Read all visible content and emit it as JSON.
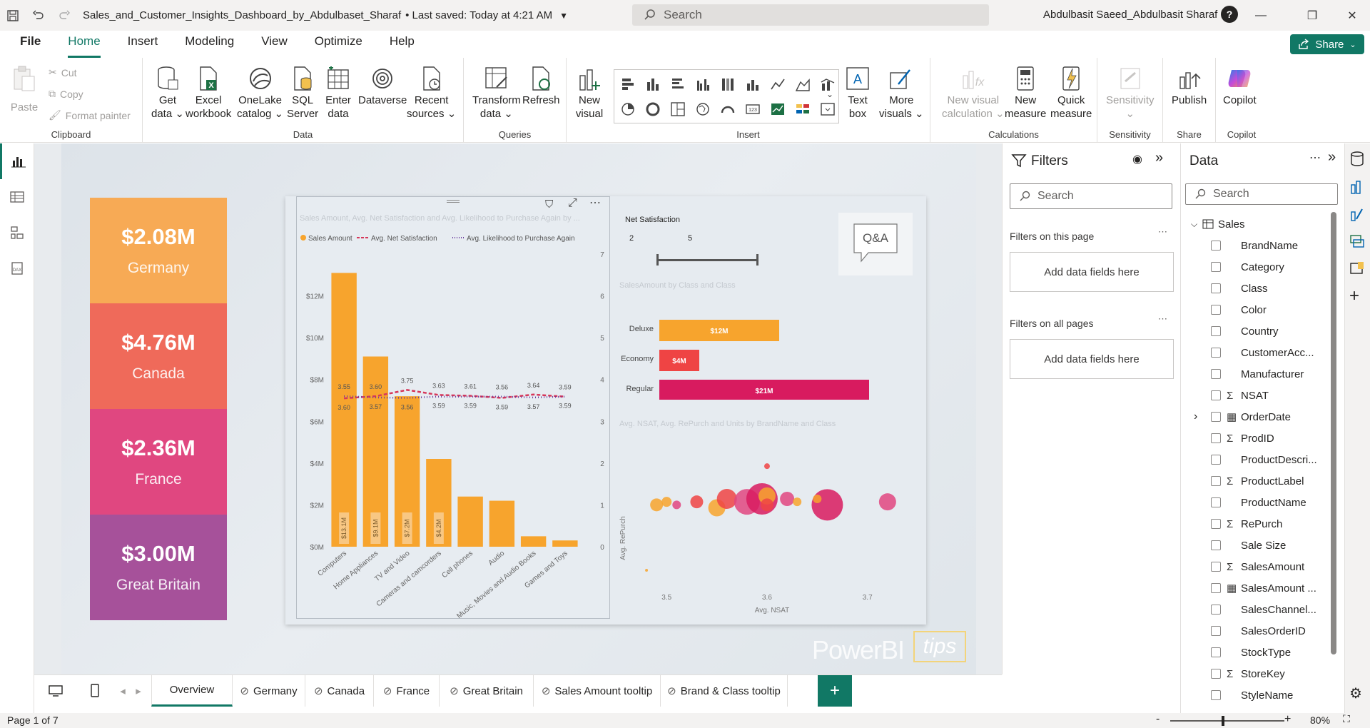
{
  "titlebar": {
    "doc_title": "Sales_and_Customer_Insights_Dashboard_by_Abdulbaset_Sharaf",
    "saved": "• Last saved: Today at 4:21 AM",
    "search_placeholder": "Search",
    "user": "Abdulbasit Saeed_Abdulbasit Sharaf"
  },
  "menu": {
    "items": [
      "File",
      "Home",
      "Insert",
      "Modeling",
      "View",
      "Optimize",
      "Help"
    ],
    "active": "Home",
    "share": "Share"
  },
  "ribbon": {
    "clipboard": {
      "paste": "Paste",
      "cut": "Cut",
      "copy": "Copy",
      "format_painter": "Format painter",
      "label": "Clipboard"
    },
    "data": {
      "buttons": [
        {
          "l1": "Get",
          "l2": "data ⌄"
        },
        {
          "l1": "Excel",
          "l2": "workbook"
        },
        {
          "l1": "OneLake",
          "l2": "catalog ⌄"
        },
        {
          "l1": "SQL",
          "l2": "Server"
        },
        {
          "l1": "Enter",
          "l2": "data"
        },
        {
          "l1": "Dataverse",
          "l2": ""
        },
        {
          "l1": "Recent",
          "l2": "sources ⌄"
        }
      ],
      "label": "Data"
    },
    "queries": {
      "transform_l1": "Transform",
      "transform_l2": "data ⌄",
      "refresh": "Refresh",
      "label": "Queries"
    },
    "insert": {
      "new_visual_l1": "New",
      "new_visual_l2": "visual",
      "text_box_l1": "Text",
      "text_box_l2": "box",
      "more_visuals_l1": "More",
      "more_visuals_l2": "visuals ⌄",
      "label": "Insert"
    },
    "calculations": {
      "nvc_l1": "New visual",
      "nvc_l2": "calculation ⌄",
      "nm_l1": "New",
      "nm_l2": "measure",
      "qm_l1": "Quick",
      "qm_l2": "measure",
      "label": "Calculations"
    },
    "sensitivity": {
      "btn": "Sensitivity",
      "label": "Sensitivity"
    },
    "share": {
      "publish": "Publish",
      "label": "Share"
    },
    "copilot": {
      "btn": "Copilot",
      "label": "Copilot"
    }
  },
  "cards": [
    {
      "value": "$2.08M",
      "label": "Germany",
      "color": "#f7aa55"
    },
    {
      "value": "$4.76M",
      "label": "Canada",
      "color": "#ef6a5a"
    },
    {
      "value": "$2.36M",
      "label": "France",
      "color": "#e04780"
    },
    {
      "value": "$3.00M",
      "label": "Great Britain",
      "color": "#a6519a"
    }
  ],
  "chart_data": [
    {
      "type": "bar",
      "title": "Sales Amount, Avg. Net Satisfaction and Avg. Likelihood to Purchase Again by ...",
      "legend": [
        "Sales Amount",
        "Avg. Net Satisfaction",
        "Avg. Likelihood to Purchase Again"
      ],
      "categories": [
        "Computers",
        "Home Appliances",
        "TV and Video",
        "Cameras and camcorders",
        "Cell phones",
        "Audio",
        "Music, Movies and Audio Books",
        "Games and Toys"
      ],
      "series": [
        {
          "name": "Sales Amount",
          "values": [
            13.1,
            9.1,
            7.2,
            4.2,
            2.4,
            2.2,
            0.5,
            0.3
          ],
          "labels": [
            "$13.1M",
            "$9.1M",
            "$7.2M",
            "$4.2M",
            "",
            "",
            "",
            ""
          ]
        },
        {
          "name": "Avg. Net Satisfaction",
          "values": [
            3.55,
            3.6,
            3.75,
            3.63,
            3.61,
            3.56,
            3.64,
            3.59
          ]
        },
        {
          "name": "Avg. Likelihood to Purchase Again",
          "values": [
            3.6,
            3.57,
            3.56,
            3.59,
            3.59,
            3.59,
            3.57,
            3.59
          ]
        }
      ],
      "y_ticks": [
        "$0M",
        "$2M",
        "$4M",
        "$6M",
        "$8M",
        "$10M",
        "$12M"
      ],
      "y2_ticks": [
        "0",
        "1",
        "2",
        "3",
        "4",
        "5",
        "6",
        "7"
      ],
      "ylim": [
        0,
        14
      ],
      "y2lim": [
        0,
        7
      ]
    },
    {
      "type": "bar",
      "orientation": "horizontal",
      "title": "SalesAmount by Class and Class",
      "categories": [
        "Deluxe",
        "Economy",
        "Regular"
      ],
      "values": [
        12,
        4,
        21
      ],
      "labels": [
        "$12M",
        "$4M",
        "$21M"
      ],
      "colors": [
        "#f7a42d",
        "#ef4444",
        "#d81b5f"
      ]
    },
    {
      "type": "scatter",
      "title": "Avg. NSAT, Avg. RePurch and Units by BrandName and Class",
      "xlabel": "Avg. NSAT",
      "ylabel": "Avg. RePurch",
      "x_ticks": [
        "3.5",
        "3.6",
        "3.7"
      ],
      "xlim": [
        3.47,
        3.74
      ],
      "ylim": [
        3.44,
        3.68
      ],
      "points": [
        {
          "x": 3.48,
          "y": 3.47,
          "r": 2,
          "c": "#f7a42d"
        },
        {
          "x": 3.49,
          "y": 3.58,
          "r": 9,
          "c": "#f7a42d"
        },
        {
          "x": 3.5,
          "y": 3.585,
          "r": 7,
          "c": "#f7a42d"
        },
        {
          "x": 3.51,
          "y": 3.58,
          "r": 6,
          "c": "#e04780"
        },
        {
          "x": 3.53,
          "y": 3.585,
          "r": 9,
          "c": "#ef4444"
        },
        {
          "x": 3.55,
          "y": 3.575,
          "r": 12,
          "c": "#f7a42d"
        },
        {
          "x": 3.56,
          "y": 3.59,
          "r": 14,
          "c": "#ef4444"
        },
        {
          "x": 3.58,
          "y": 3.585,
          "r": 18,
          "c": "#e04780"
        },
        {
          "x": 3.595,
          "y": 3.59,
          "r": 22,
          "c": "#d81b5f"
        },
        {
          "x": 3.6,
          "y": 3.595,
          "r": 12,
          "c": "#f7a42d"
        },
        {
          "x": 3.6,
          "y": 3.58,
          "r": 9,
          "c": "#ef4444"
        },
        {
          "x": 3.62,
          "y": 3.59,
          "r": 10,
          "c": "#e04780"
        },
        {
          "x": 3.63,
          "y": 3.585,
          "r": 6,
          "c": "#f7a42d"
        },
        {
          "x": 3.6,
          "y": 3.645,
          "r": 4,
          "c": "#ef4444"
        },
        {
          "x": 3.66,
          "y": 3.58,
          "r": 22,
          "c": "#d81b5f"
        },
        {
          "x": 3.65,
          "y": 3.59,
          "r": 6,
          "c": "#f7a42d"
        },
        {
          "x": 3.72,
          "y": 3.585,
          "r": 12,
          "c": "#e04780"
        }
      ]
    }
  ],
  "slicer": {
    "title": "Net Satisfaction",
    "min": "2",
    "max": "5"
  },
  "qa_label": "Q&A",
  "watermark": "PowerBI",
  "watermark_tips": "tips",
  "filters": {
    "title": "Filters",
    "search": "Search",
    "on_page": "Filters on this page",
    "on_all": "Filters on all pages",
    "add_fields": "Add data fields here"
  },
  "data_pane": {
    "title": "Data",
    "search": "Search",
    "table": "Sales",
    "fields": [
      {
        "name": "BrandName",
        "type": ""
      },
      {
        "name": "Category",
        "type": ""
      },
      {
        "name": "Class",
        "type": ""
      },
      {
        "name": "Color",
        "type": ""
      },
      {
        "name": "Country",
        "type": ""
      },
      {
        "name": "CustomerAcc...",
        "type": ""
      },
      {
        "name": "Manufacturer",
        "type": ""
      },
      {
        "name": "NSAT",
        "type": "Σ"
      },
      {
        "name": "OrderDate",
        "type": "cal"
      },
      {
        "name": "ProdID",
        "type": "Σ"
      },
      {
        "name": "ProductDescri...",
        "type": ""
      },
      {
        "name": "ProductLabel",
        "type": "Σ"
      },
      {
        "name": "ProductName",
        "type": ""
      },
      {
        "name": "RePurch",
        "type": "Σ"
      },
      {
        "name": "Sale Size",
        "type": ""
      },
      {
        "name": "SalesAmount",
        "type": "Σ"
      },
      {
        "name": "SalesAmount ...",
        "type": "cal"
      },
      {
        "name": "SalesChannel...",
        "type": ""
      },
      {
        "name": "SalesOrderID",
        "type": ""
      },
      {
        "name": "StockType",
        "type": ""
      },
      {
        "name": "StoreKey",
        "type": "Σ"
      },
      {
        "name": "StyleName",
        "type": ""
      }
    ]
  },
  "tabs": [
    "Overview",
    "Germany",
    "Canada",
    "France",
    "Great Britain",
    "Sales Amount tooltip",
    "Brand & Class tooltip"
  ],
  "status": {
    "page": "Page 1 of 7",
    "zoom": "80%",
    "zoom_minus": "-",
    "zoom_plus": "+"
  },
  "colors": {
    "accent": "#117865",
    "bar": "#f7a42d"
  }
}
